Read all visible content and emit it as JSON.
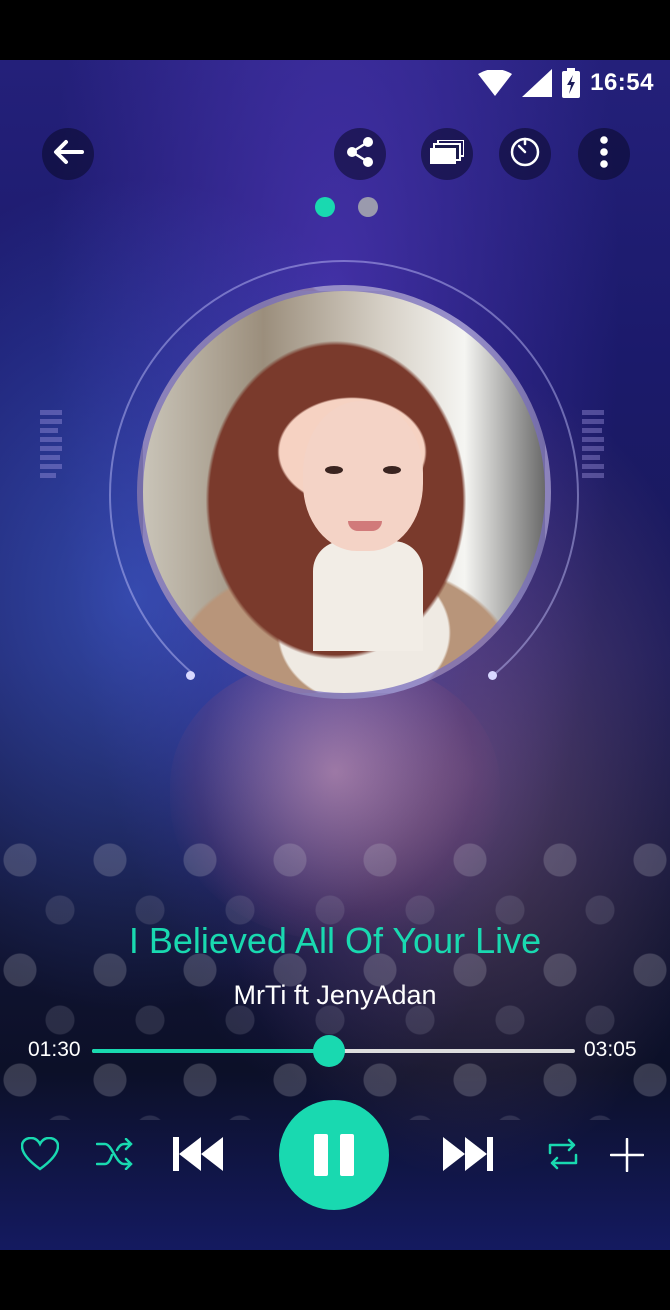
{
  "status_bar": {
    "time": "16:54"
  },
  "header": {
    "icons": [
      "back-arrow-icon",
      "share-icon",
      "queue-icon",
      "sleep-timer-icon",
      "more-vert-icon"
    ]
  },
  "pager": {
    "pages": 2,
    "active_index": 0
  },
  "now_playing": {
    "title": "I Believed All Of Your Live",
    "artist": "MrTi ft JenyAdan"
  },
  "progress": {
    "elapsed": "01:30",
    "duration": "03:05",
    "fraction": 0.49
  },
  "controls": {
    "icons": [
      "heart-icon",
      "shuffle-icon",
      "previous-icon",
      "pause-icon",
      "next-icon",
      "repeat-icon",
      "add-icon"
    ],
    "state": "playing"
  },
  "colors": {
    "accent": "#19d9b0",
    "text": "#ffffff",
    "inactive_dot": "#9a9aad"
  }
}
